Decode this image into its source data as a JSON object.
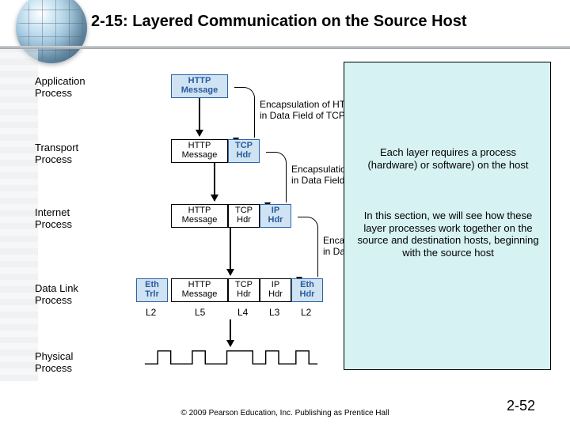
{
  "slide": {
    "title": "2-15: Layered Communication on the Source Host",
    "page_number": "2-52",
    "copyright": "© 2009 Pearson Education, Inc.  Publishing as Prentice Hall"
  },
  "processes": {
    "application": "Application\nProcess",
    "transport": "Transport\nProcess",
    "internet": "Internet\nProcess",
    "datalink": "Data Link\nProcess",
    "physical": "Physical\nProcess"
  },
  "boxes": {
    "http": "HTTP\nMessage",
    "tcp": "TCP\nHdr",
    "ip": "IP\nHdr",
    "eth_hdr": "Eth\nHdr",
    "eth_trlr": "Eth\nTrlr"
  },
  "encapsulation": {
    "app_to_tcp": "Encapsulation of HTTP Message\nin Data Field of TCP Segment",
    "tcp_to_ip": "Encapsulation of TCP Segment\nin Data Field of IP Packet",
    "ip_to_eth": "Encapsulation of IP Packet\nin Data Field of Ethernet Frame"
  },
  "layer_tags": {
    "l2a": "L2",
    "l5": "L5",
    "l4": "L4",
    "l3": "L3",
    "l2b": "L2"
  },
  "callout": {
    "p1": "Each layer requires a process (hardware) or software) on the host",
    "p2": "In this section, we will see how these layer processes work together on the source and destination hosts, beginning with the source host"
  }
}
